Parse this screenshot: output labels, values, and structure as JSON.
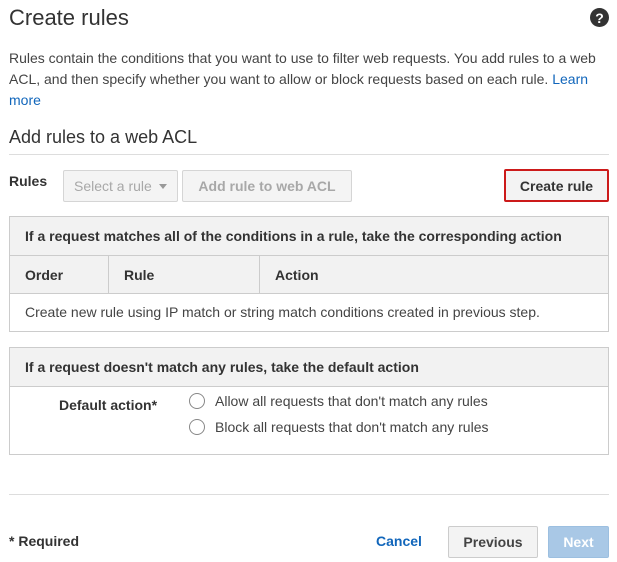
{
  "header": {
    "title": "Create rules",
    "help_icon_glyph": "?"
  },
  "intro": {
    "text": "Rules contain the conditions that you want to use to filter web requests. You add rules to a web ACL, and then specify whether you want to allow or block requests based on each rule. ",
    "link": "Learn more"
  },
  "add_rules": {
    "subtitle": "Add rules to a web ACL",
    "rules_label": "Rules",
    "select_placeholder": "Select a rule",
    "add_button": "Add rule to web ACL",
    "create_button": "Create rule"
  },
  "rules_table": {
    "heading": "If a request matches all of the conditions in a rule, take the corresponding action",
    "columns": [
      "Order",
      "Rule",
      "Action"
    ],
    "empty_message": "Create new rule using IP match or string match conditions created in previous step."
  },
  "default_action": {
    "heading": "If a request doesn't match any rules, take the default action",
    "label": "Default action*",
    "options": [
      "Allow all requests that don't match any rules",
      "Block all requests that don't match any rules"
    ]
  },
  "footer": {
    "required_note": "* Required",
    "cancel": "Cancel",
    "previous": "Previous",
    "next": "Next"
  },
  "colors": {
    "link": "#1166bb",
    "create_rule_border": "#cc1a1a",
    "next_button_bg": "#a9c8e6",
    "panel_header_bg": "#f2f2f2"
  }
}
